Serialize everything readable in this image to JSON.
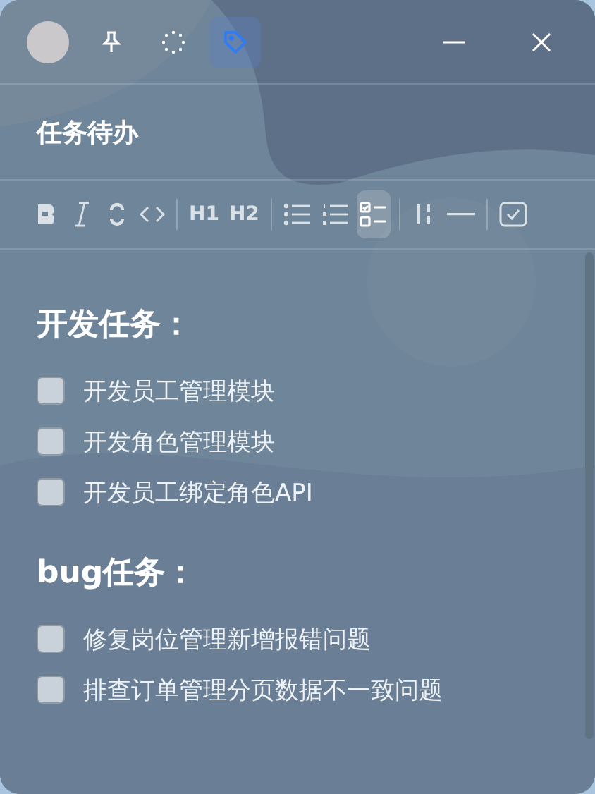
{
  "titlebar": {
    "tools": [
      {
        "kind": "pin",
        "selected": false
      },
      {
        "kind": "spinner",
        "selected": false
      },
      {
        "kind": "tag",
        "selected": true
      }
    ]
  },
  "title": "任务待办",
  "toolbar": [
    {
      "kind": "bold",
      "selected": false
    },
    {
      "kind": "italic",
      "selected": false
    },
    {
      "kind": "strike",
      "selected": false
    },
    {
      "kind": "code",
      "selected": false
    },
    {
      "kind": "divider"
    },
    {
      "kind": "text",
      "label": "H1",
      "selected": false
    },
    {
      "kind": "text",
      "label": "H2",
      "selected": false
    },
    {
      "kind": "divider"
    },
    {
      "kind": "bullet-list",
      "selected": false
    },
    {
      "kind": "ordered-list",
      "selected": false
    },
    {
      "kind": "task-list",
      "selected": true
    },
    {
      "kind": "divider"
    },
    {
      "kind": "columns",
      "selected": false
    },
    {
      "kind": "rule",
      "selected": false
    },
    {
      "kind": "divider"
    },
    {
      "kind": "checkbox",
      "selected": false
    }
  ],
  "sections": [
    {
      "heading": "开发任务：",
      "tasks": [
        {
          "text": "开发员工管理模块",
          "checked": false
        },
        {
          "text": "开发角色管理模块",
          "checked": false
        },
        {
          "text": "开发员工绑定角色API",
          "checked": false
        }
      ]
    },
    {
      "heading": "bug任务：",
      "tasks": [
        {
          "text": "修复岗位管理新增报错问题",
          "checked": false
        },
        {
          "text": "排查订单管理分页数据不一致问题",
          "checked": false
        }
      ]
    }
  ]
}
